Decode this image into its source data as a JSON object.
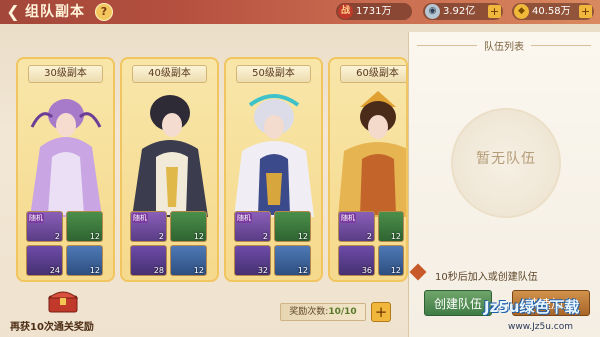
{
  "header": {
    "title": "组队副本",
    "help": "?",
    "back_icon": "back-arrow-icon",
    "resources": [
      {
        "icon": "battle-power-icon",
        "glyph": "战",
        "value": "1731万"
      },
      {
        "icon": "silver-coin-icon",
        "glyph": "◉",
        "value": "3.92亿"
      },
      {
        "icon": "gold-ingot-icon",
        "glyph": "◆",
        "value": "40.58万"
      }
    ]
  },
  "cards": [
    {
      "title": "30级副本",
      "hero_color": "#b98ad6",
      "rewards": [
        {
          "type": "chest",
          "qty": "2",
          "tag": "随机"
        },
        {
          "type": "fruit",
          "qty": "12"
        },
        {
          "type": "orb",
          "qty": "24"
        },
        {
          "type": "gem",
          "qty": "12"
        }
      ]
    },
    {
      "title": "40级副本",
      "hero_color": "#3d3a45",
      "rewards": [
        {
          "type": "chest",
          "qty": "2",
          "tag": "随机"
        },
        {
          "type": "fruit",
          "qty": "12"
        },
        {
          "type": "orb",
          "qty": "28"
        },
        {
          "type": "gem",
          "qty": "12"
        }
      ]
    },
    {
      "title": "50级副本",
      "hero_color": "#d9d6e4",
      "rewards": [
        {
          "type": "chest",
          "qty": "2",
          "tag": "随机"
        },
        {
          "type": "fruit",
          "qty": "12"
        },
        {
          "type": "orb",
          "qty": "32"
        },
        {
          "type": "gem",
          "qty": "12"
        }
      ]
    },
    {
      "title": "60级副本",
      "hero_color": "#d8973c",
      "rewards": [
        {
          "type": "chest",
          "qty": "2",
          "tag": "随机"
        },
        {
          "type": "fruit",
          "qty": "12"
        },
        {
          "type": "orb",
          "qty": "36"
        },
        {
          "type": "gem",
          "qty": "12"
        }
      ]
    }
  ],
  "panel": {
    "title": "队伍列表",
    "empty_text": "暂无队伍",
    "auto_join_text": "10秒后加入或创建队伍",
    "create_button": "创建队伍",
    "quick_button": "快速加入"
  },
  "bottom": {
    "chest_label": "再获10次通关奖励",
    "reward_label": "奖励次数:",
    "reward_count": "10/10",
    "plus": "+"
  },
  "watermark": {
    "main": "Jz5u绿色下载",
    "sub": "www.Jz5u.com"
  }
}
